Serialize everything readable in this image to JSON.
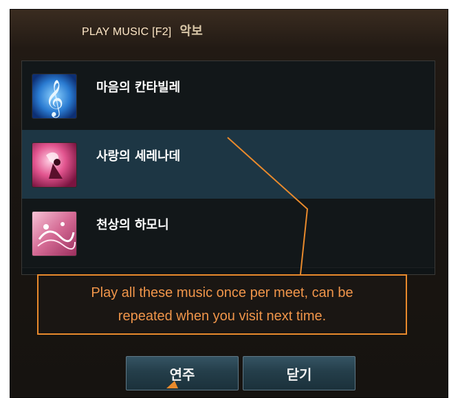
{
  "window": {
    "title": "PLAY MUSIC [F2]",
    "title_kr": "악보"
  },
  "songs": [
    {
      "name": "마음의 칸타빌레",
      "icon": "treble-clef-icon",
      "selected": false
    },
    {
      "name": "사랑의 세레나데",
      "icon": "serenade-icon",
      "selected": true
    },
    {
      "name": "천상의 하모니",
      "icon": "harmony-icon",
      "selected": false
    }
  ],
  "note": {
    "text": "Play all these music once per meet, can be\nrepeated when you visit next time."
  },
  "buttons": {
    "play": "연주",
    "close": "닫기"
  },
  "colors": {
    "annotation": "#e98a2c",
    "selected_row": "#1d3644"
  }
}
